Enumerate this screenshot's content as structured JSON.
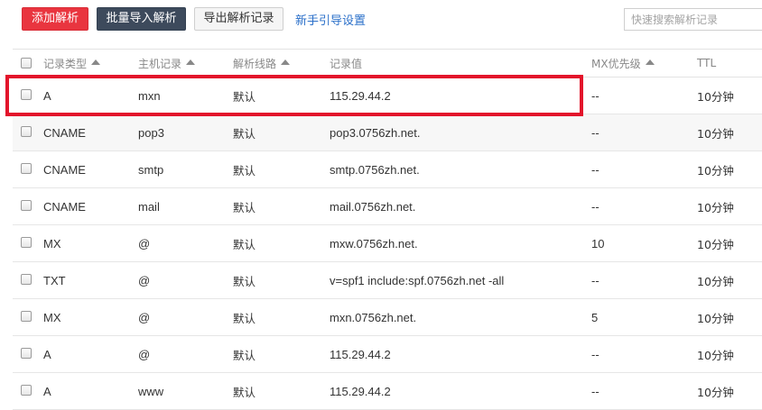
{
  "toolbar": {
    "add_label": "添加解析",
    "batch_import_label": "批量导入解析",
    "export_label": "导出解析记录",
    "guide_label": "新手引导设置"
  },
  "search": {
    "placeholder": "快速搜索解析记录"
  },
  "table": {
    "headers": {
      "type": "记录类型",
      "host": "主机记录",
      "line": "解析线路",
      "value": "记录值",
      "mx": "MX优先级",
      "ttl": "TTL"
    },
    "rows": [
      {
        "type": "A",
        "host": "mxn",
        "line": "默认",
        "value": "115.29.44.2",
        "mx": "--",
        "ttl": "10分钟"
      },
      {
        "type": "CNAME",
        "host": "pop3",
        "line": "默认",
        "value": "pop3.0756zh.net.",
        "mx": "--",
        "ttl": "10分钟"
      },
      {
        "type": "CNAME",
        "host": "smtp",
        "line": "默认",
        "value": "smtp.0756zh.net.",
        "mx": "--",
        "ttl": "10分钟"
      },
      {
        "type": "CNAME",
        "host": "mail",
        "line": "默认",
        "value": "mail.0756zh.net.",
        "mx": "--",
        "ttl": "10分钟"
      },
      {
        "type": "MX",
        "host": "@",
        "line": "默认",
        "value": "mxw.0756zh.net.",
        "mx": "10",
        "ttl": "10分钟"
      },
      {
        "type": "TXT",
        "host": "@",
        "line": "默认",
        "value": "v=spf1 include:spf.0756zh.net -all",
        "mx": "--",
        "ttl": "10分钟"
      },
      {
        "type": "MX",
        "host": "@",
        "line": "默认",
        "value": "mxn.0756zh.net.",
        "mx": "5",
        "ttl": "10分钟"
      },
      {
        "type": "A",
        "host": "@",
        "line": "默认",
        "value": "115.29.44.2",
        "mx": "--",
        "ttl": "10分钟"
      },
      {
        "type": "A",
        "host": "www",
        "line": "默认",
        "value": "115.29.44.2",
        "mx": "--",
        "ttl": "10分钟"
      }
    ]
  },
  "colors": {
    "add_button": "#e9353f",
    "batch_button": "#3d4a5c",
    "link": "#2a6fc9",
    "annotation_box": "#e3142b"
  }
}
